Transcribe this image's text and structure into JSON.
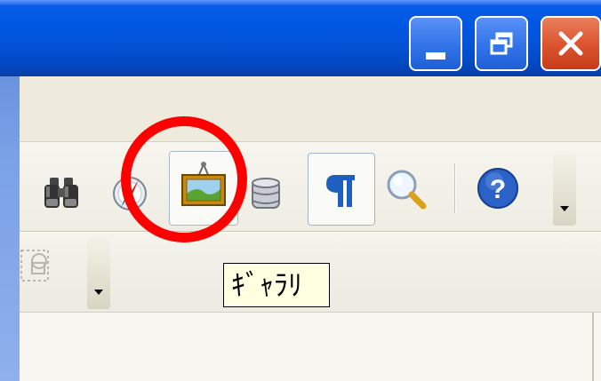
{
  "window": {
    "caption_buttons": [
      {
        "name": "minimize",
        "icon": "minimize-icon"
      },
      {
        "name": "restore",
        "icon": "restore-icon"
      },
      {
        "name": "close",
        "icon": "close-icon"
      }
    ]
  },
  "toolbar": {
    "buttons": [
      {
        "name": "find",
        "icon": "binoculars-icon"
      },
      {
        "name": "navigator",
        "icon": "compass-icon"
      },
      {
        "name": "gallery",
        "icon": "gallery-picture-icon",
        "pressed": true
      },
      {
        "name": "data-sources",
        "icon": "database-icon"
      },
      {
        "name": "formatting-marks",
        "icon": "pilcrow-icon",
        "toggled": true
      },
      {
        "name": "zoom",
        "icon": "magnifier-icon"
      },
      {
        "name": "help",
        "icon": "help-icon"
      }
    ]
  },
  "tooltip": {
    "text": "ｷﾞｬﾗﾘ"
  },
  "colors": {
    "titlebar": "#0453d6",
    "highlight_ring": "#ff0000",
    "tooltip_bg": "#ffffe1",
    "toolbar_bg": "#ece9d8"
  }
}
